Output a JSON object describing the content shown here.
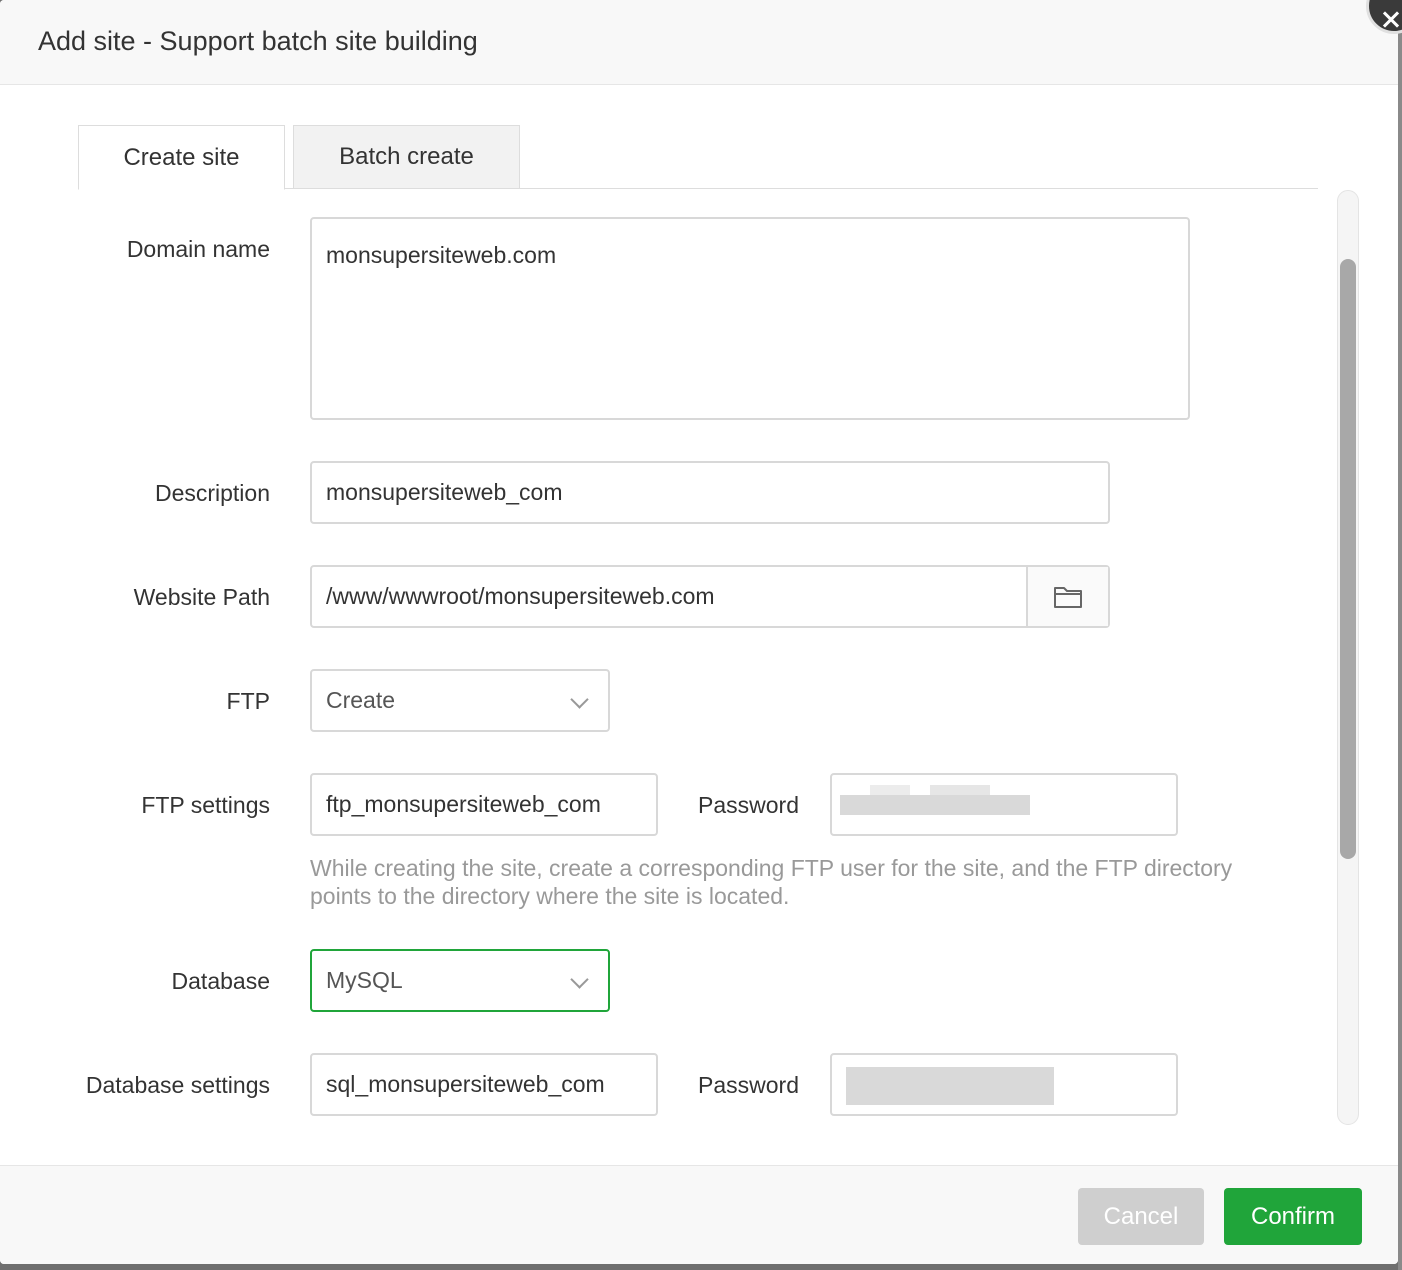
{
  "dialog": {
    "title": "Add site - Support batch site building"
  },
  "tabs": [
    {
      "label": "Create site",
      "active": true
    },
    {
      "label": "Batch create",
      "active": false
    }
  ],
  "form": {
    "domain": {
      "label": "Domain name",
      "value": "monsupersiteweb.com"
    },
    "description": {
      "label": "Description",
      "value": "monsupersiteweb_com"
    },
    "path": {
      "label": "Website Path",
      "value": "/www/wwwroot/monsupersiteweb.com",
      "icon": "folder-icon"
    },
    "ftp": {
      "label": "FTP",
      "value": "Create"
    },
    "ftp_settings": {
      "label": "FTP settings",
      "username": "ftp_monsupersiteweb_com",
      "password_label": "Password",
      "hint": "While creating the site, create a corresponding FTP user for the site, and the FTP directory points to the directory where the site is located."
    },
    "database": {
      "label": "Database",
      "value": "MySQL"
    },
    "database_settings": {
      "label": "Database settings",
      "username": "sql_monsupersiteweb_com",
      "password_label": "Password"
    }
  },
  "footer": {
    "cancel_label": "Cancel",
    "confirm_label": "Confirm"
  },
  "colors": {
    "accent": "#20a53a",
    "focus_border": "#20a53a",
    "disabled_button": "#cfcfcf"
  }
}
